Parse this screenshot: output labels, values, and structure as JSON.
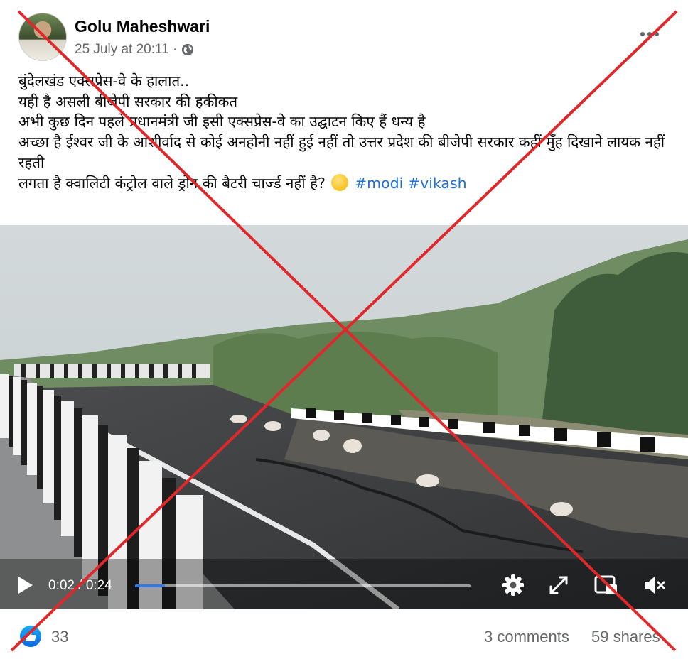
{
  "post": {
    "author": "Golu Maheshwari",
    "timestamp": "25 July at 20:11 ·",
    "audience_icon": "globe-icon",
    "more_icon": "more-options-icon",
    "text_lines": [
      "बुंदेलखंड एक्सप्रेस-वे के हालात..",
      "यही है असली बीजेपी सरकार की हकीकत",
      "अभी कुछ दिन पहले प्रधानमंत्री जी इसी एक्सप्रेस-वे का उद्घाटन किए  हैं धन्य है",
      "अच्छा है ईश्वर  जी के आशीर्वाद से कोई अनहोनी नहीं हुई नहीं तो उत्तर प्रदेश की बीजेपी सरकार कहीं मुँह दिखाने लायक नहीं रहती",
      "लगता है क्वालिटी कंट्रोल वाले ड्रोन की बैटरी चार्ज्ड नहीं  है?"
    ],
    "emoji": "thinking-face-emoji",
    "hashtags": [
      "#modi",
      "#vikash"
    ]
  },
  "video": {
    "current_time": "0:02",
    "separator": "/",
    "duration": "0:24",
    "progress": 0.09,
    "icons": [
      "play-icon",
      "settings-gear-icon",
      "fullscreen-icon",
      "picture-in-picture-icon",
      "muted-speaker-icon"
    ]
  },
  "footer": {
    "reaction_icon": "like-icon",
    "reactions_count": "33",
    "comments": "3 comments",
    "shares": "59 shares"
  },
  "overlay": {
    "type": "red-cross",
    "color": "#e0282b"
  }
}
